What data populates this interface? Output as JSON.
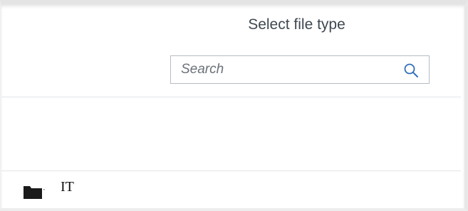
{
  "dialog": {
    "title": "Select file type"
  },
  "search": {
    "placeholder": "Search",
    "value": "",
    "icon": "search-icon"
  },
  "list": {
    "items": [
      {
        "label": "IT",
        "icon": "folder-icon"
      }
    ]
  }
}
